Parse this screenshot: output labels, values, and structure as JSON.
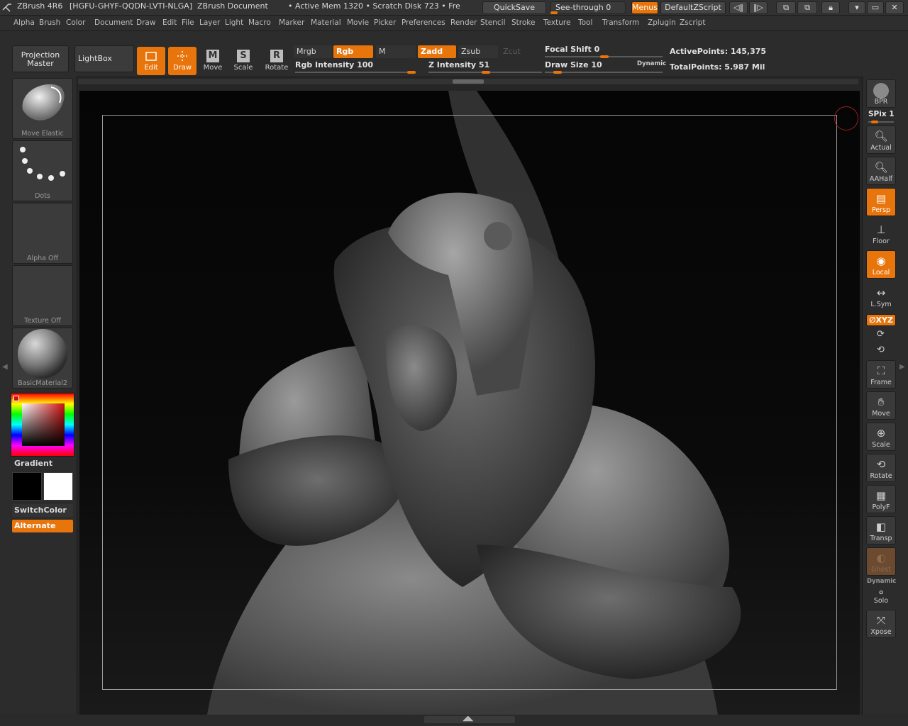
{
  "titlebar": {
    "app": "ZBrush 4R6",
    "serial": "[HGFU-GHYF-QQDN-LVTI-NLGA]",
    "doc": "ZBrush Document",
    "status": "• Active Mem 1320 • Scratch Disk 723 • Fre",
    "quicksave": "QuickSave",
    "seethrough": "See-through  0",
    "seethrough_value": 0,
    "menus": "Menus",
    "zscript": "DefaultZScript"
  },
  "menubar": {
    "items": [
      "Alpha",
      "Brush",
      "Color",
      "Document",
      "Draw",
      "Edit",
      "File",
      "Layer",
      "Light",
      "Macro",
      "Marker",
      "Material",
      "Movie",
      "Picker",
      "Preferences",
      "Render",
      "Stencil",
      "Stroke",
      "Texture",
      "Tool",
      "Transform",
      "Zplugin",
      "Zscript"
    ]
  },
  "shelf": {
    "projection_master": "Projection Master",
    "lightbox": "LightBox",
    "edit": "Edit",
    "draw": "Draw",
    "move": "Move",
    "scale": "Scale",
    "rotate": "Rotate",
    "mrgb": "Mrgb",
    "rgb": "Rgb",
    "m": "M",
    "zadd": "Zadd",
    "zsub": "Zsub",
    "zcut": "Zcut",
    "rgb_intensity": "Rgb  Intensity 100",
    "rgb_intensity_value": 100,
    "z_intensity": "Z  Intensity 51",
    "z_intensity_value": 51,
    "focal_shift": "Focal  Shift 0",
    "focal_shift_value": 0,
    "draw_size": "Draw  Size 10",
    "draw_size_value": 10,
    "dynamic": "Dynamic",
    "active_points": "ActivePoints: 145,375",
    "total_points": "TotalPoints: 5.987  Mil"
  },
  "leftpanel": {
    "brush": "Move  Elastic",
    "stroke": "Dots",
    "alpha": "Alpha  Off",
    "texture": "Texture  Off",
    "material": "BasicMaterial2",
    "gradient": "Gradient",
    "switchcolor": "SwitchColor",
    "alternate": "Alternate"
  },
  "rightpanel": {
    "bpr": "BPR",
    "spix": "SPix 1",
    "spix_value": 1,
    "actual": "Actual",
    "aahalf": "AAHalf",
    "persp": "Persp",
    "floor": "Floor",
    "local": "Local",
    "lsym": "L.Sym",
    "xyz": "∅XYZ",
    "frame": "Frame",
    "move": "Move",
    "scale": "Scale",
    "rotate": "Rotate",
    "polyf": "PolyF",
    "transp": "Transp",
    "ghost": "Ghost",
    "dynamic": "Dynamic",
    "solo": "Solo",
    "xpose": "Xpose"
  },
  "colors": {
    "accent": "#e8740c",
    "panel": "#2c2c2c",
    "canvas": "#050505"
  }
}
